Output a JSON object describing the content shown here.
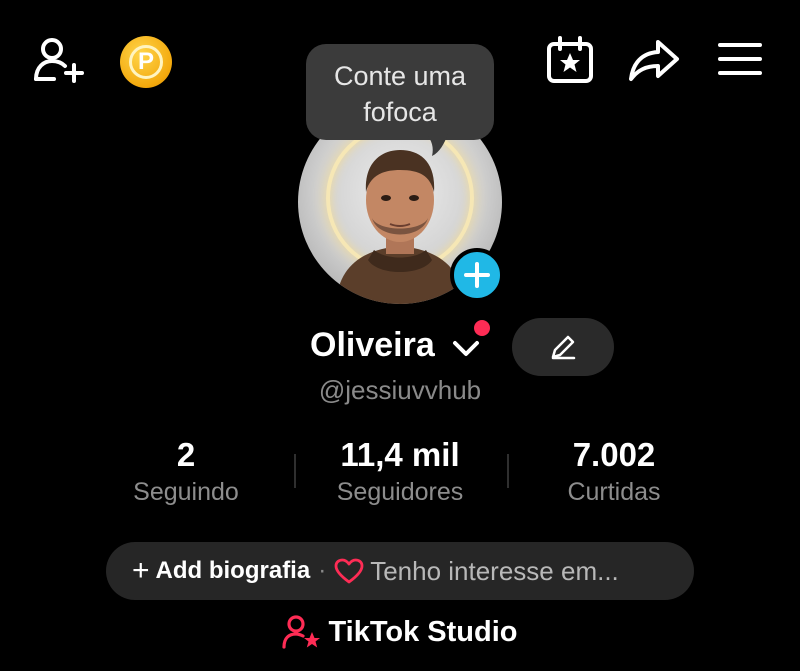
{
  "header": {
    "icons": [
      "add-friend-icon",
      "coin-icon",
      "calendar-star-icon",
      "share-icon",
      "menu-icon"
    ],
    "coin_letter": "P"
  },
  "tooltip": {
    "text_line1": "Conte uma",
    "text_line2": "fofoca"
  },
  "profile": {
    "name": "Oliveira",
    "handle": "@jessiuvvhub",
    "accent_color": "#fe2c55",
    "avatar_add_color": "#20b8e6"
  },
  "stats": [
    {
      "value": "2",
      "label": "Seguindo"
    },
    {
      "value": "11,4 mil",
      "label": "Seguidores"
    },
    {
      "value": "7.002",
      "label": "Curtidas"
    }
  ],
  "bio": {
    "plus": "+",
    "add_label": "Add biografia",
    "separator": "·",
    "interest_text": "Tenho interesse em..."
  },
  "studio": {
    "label": "TikTok Studio"
  }
}
